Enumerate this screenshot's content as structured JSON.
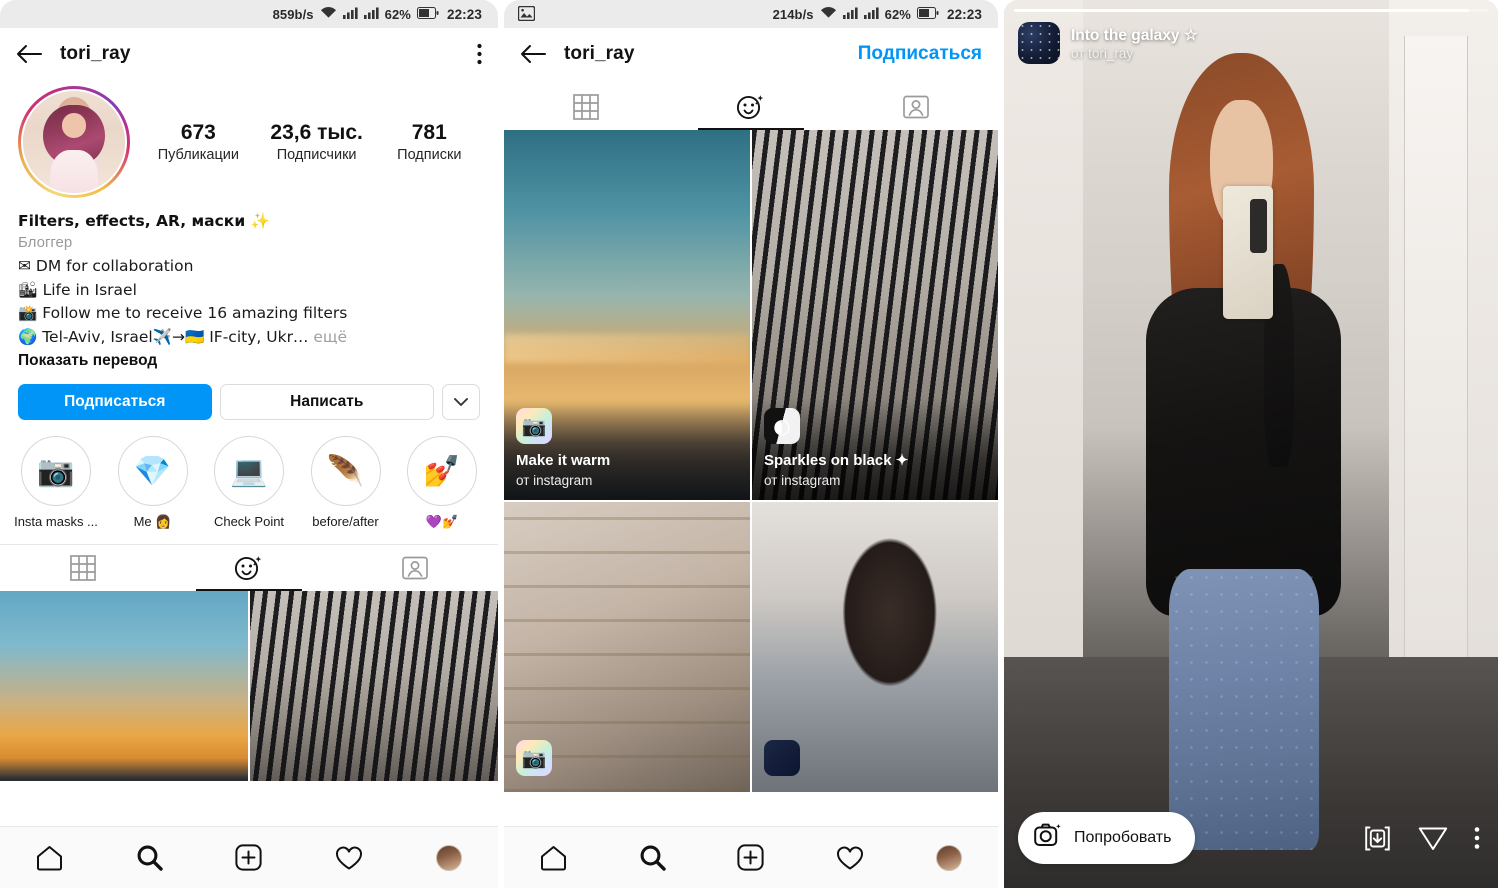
{
  "panels": {
    "left": {
      "statusbar": {
        "speed": "859b/s",
        "battery_pct": "62%",
        "time": "22:23"
      },
      "appbar": {
        "title": "tori_ray",
        "back_icon": "arrow-left-icon",
        "menu_icon": "three-dots-vertical-icon"
      },
      "stats": [
        {
          "num": "673",
          "label": "Публикации"
        },
        {
          "num": "23,6 тыс.",
          "label": "Подписчики"
        },
        {
          "num": "781",
          "label": "Подписки"
        }
      ],
      "bio": {
        "name": "Filters, effects, AR, маски ✨",
        "category": "Блоггер",
        "lines": [
          "✉ DM for collaboration",
          "🏙 Life in Israel",
          "📸 Follow me to receive 16 amazing filters",
          "🌍 Tel-Aviv, Israel✈️→🇺🇦 IF-city, Ukr…"
        ],
        "more": " ещё",
        "translate": "Показать перевод"
      },
      "buttons": {
        "follow": "Подписаться",
        "message": "Написать",
        "dropdown_icon": "chevron-down-icon"
      },
      "highlights": [
        {
          "label": "Insta masks ...",
          "emoji": "📷"
        },
        {
          "label": "Me 👩",
          "emoji": "💎"
        },
        {
          "label": "Check Point",
          "emoji": "💻"
        },
        {
          "label": "before/after",
          "emoji": "🪶"
        },
        {
          "label": "💜💅",
          "emoji": "💅"
        }
      ],
      "tabs": [
        {
          "icon": "grid-icon",
          "active": false
        },
        {
          "icon": "effects-smiley-icon",
          "active": true
        },
        {
          "icon": "tagged-person-icon",
          "active": false
        }
      ]
    },
    "mid": {
      "statusbar": {
        "left_icon": "image-notification-icon",
        "speed": "214b/s",
        "battery_pct": "62%",
        "time": "22:23"
      },
      "appbar": {
        "title": "tori_ray",
        "follow_label": "Подписаться",
        "back_icon": "arrow-left-icon"
      },
      "tabs": [
        {
          "icon": "grid-icon",
          "active": false
        },
        {
          "icon": "effects-smiley-icon",
          "active": true
        },
        {
          "icon": "tagged-person-icon",
          "active": false
        }
      ],
      "effects": [
        {
          "title": "Make it warm",
          "author": "от instagram",
          "thumb": "rainbow-camera-icon"
        },
        {
          "title": "Sparkles on black ✦",
          "author": "от instagram",
          "thumb": "black-white-icon"
        }
      ]
    },
    "right": {
      "progress_pct": 96,
      "effect_title": "Into the galaxy ☆",
      "effect_author": "от tori_ray",
      "thumb_icon": "galaxy-thumbnail",
      "try_button": {
        "label": "Попробовать",
        "icon": "camera-sparkle-icon"
      },
      "actions": [
        {
          "icon": "save-icon"
        },
        {
          "icon": "send-paper-plane-icon"
        },
        {
          "icon": "three-dots-vertical-icon"
        }
      ]
    }
  },
  "bottomnav": [
    {
      "icon": "home-icon"
    },
    {
      "icon": "search-icon"
    },
    {
      "icon": "add-post-icon"
    },
    {
      "icon": "heart-icon"
    },
    {
      "icon": "profile-avatar"
    }
  ],
  "colors": {
    "accent": "#0095f6",
    "text": "#111111",
    "muted": "#9a9a9a",
    "badge": "#e8493c"
  }
}
